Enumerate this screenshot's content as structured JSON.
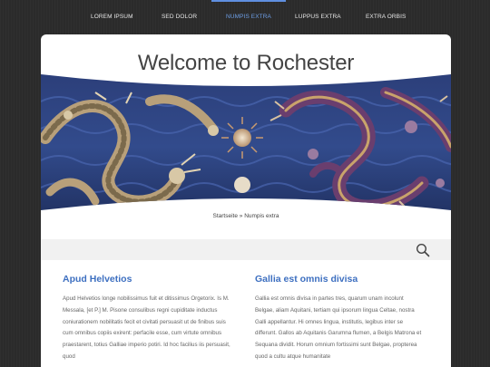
{
  "nav": {
    "items": [
      {
        "label": "Lorem Ipsum"
      },
      {
        "label": "Sed Dolor"
      },
      {
        "label": "Numpis Extra"
      },
      {
        "label": "Luppus Extra"
      },
      {
        "label": "Extra Orbis"
      }
    ],
    "active_index": 2
  },
  "header": {
    "title": "Welcome to Rochester"
  },
  "hero": {
    "image_description_icon": "dragon-mural-image"
  },
  "breadcrumb": {
    "home": "Startseite",
    "separator": "»",
    "current": "Numpis extra"
  },
  "search": {
    "icon": "search-icon"
  },
  "columns": [
    {
      "title": "Apud Helvetios",
      "text": "Apud Helvetios longe nobilissimus fuit et ditissimus Orgetorix. Is M. Messala, [et P.] M. Pisone consulibus regni cupiditate inductus coniurationem nobilitatis fecit et civitati persuasit ut de finibus suis cum omnibus copiis exirent: perfacile esse, cum virtute omnibus praestarent, totius Galliae imperio potiri. Id hoc facilius iis persuasit, quod"
    },
    {
      "title": "Gallia est omnis divisa",
      "text": "Gallia est omnis divisa in partes tres, quarum unam incolunt Belgae, aliam Aquitani, tertiam qui ipsorum lingua Celtae, nostra Galli appellantur. Hi omnes lingua, institutis, legibus inter se differunt. Gallos ab Aquitanis Garumna flumen, a Belgis Matrona et Sequana dividit. Horum omnium fortissimi sunt Belgae, propterea quod a cultu atque humanitate"
    }
  ],
  "colors": {
    "background": "#2b2b2b",
    "accent": "#3d6fc0",
    "nav_active": "#6d9ee6"
  }
}
